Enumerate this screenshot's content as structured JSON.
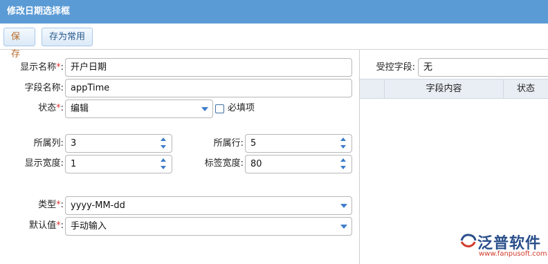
{
  "window": {
    "title": "修改日期选择框"
  },
  "toolbar": {
    "save_label": "保存",
    "save_common_label": "存为常用"
  },
  "form": {
    "display_name": {
      "label": "显示名称",
      "req": "*",
      "colon": ":",
      "value": "开户日期"
    },
    "field_name": {
      "label": "字段名称",
      "colon": ":",
      "value": "appTime"
    },
    "status": {
      "label": "状态",
      "req": "*",
      "colon": ":",
      "value": "编辑"
    },
    "required_check": {
      "label": "必填项",
      "checked": false
    },
    "column": {
      "label": "所属列",
      "colon": ":",
      "value": "3"
    },
    "row": {
      "label": "所属行",
      "colon": ":",
      "value": "5"
    },
    "display_width": {
      "label": "显示宽度",
      "colon": ":",
      "value": "1"
    },
    "label_width": {
      "label": "标签宽度",
      "colon": ":",
      "value": "80"
    },
    "type": {
      "label": "类型",
      "req": "*",
      "colon": ":",
      "value": "yyyy-MM-dd"
    },
    "default_value": {
      "label": "默认值",
      "req": "*",
      "colon": ":",
      "value": "手动输入"
    }
  },
  "controlled": {
    "label": "受控字段:",
    "value": "无",
    "columns": [
      "字段内容",
      "状态"
    ]
  },
  "brand": {
    "name": "泛普软件",
    "url": "www.fanpusoft.com"
  },
  "colors": {
    "titlebar": "#5b9bd5",
    "accent": "#3d7cc9",
    "required": "#e03030",
    "brand": "#2a4f8a"
  }
}
